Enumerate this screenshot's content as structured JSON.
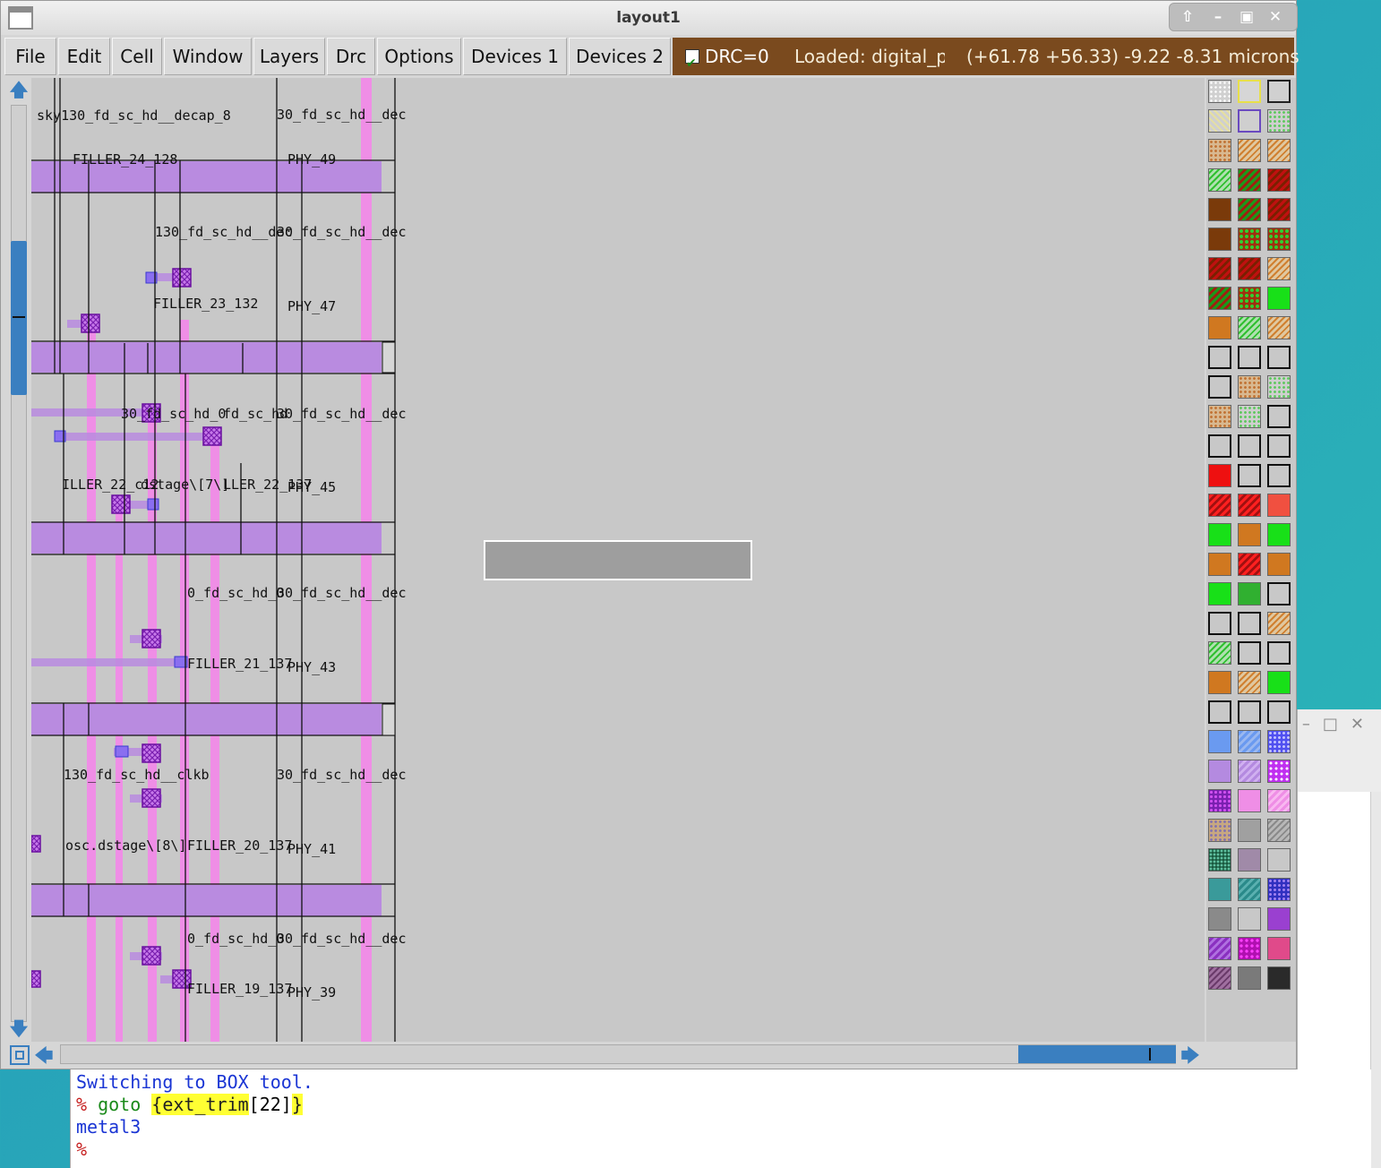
{
  "window": {
    "title": "layout1"
  },
  "menu": [
    "File",
    "Edit",
    "Cell",
    "Window",
    "Layers",
    "Drc",
    "Options",
    "Devices 1",
    "Devices 2"
  ],
  "drc": {
    "label": "DRC=0",
    "checked": true
  },
  "status": {
    "loaded": "Loaded: digital_p",
    "coords": "(+61.78 +56.33) -9.22 -8.31 microns"
  },
  "cells": [
    {
      "text": "sky130_fd_sc_hd__decap_8"
    },
    {
      "text": "30_fd_sc_hd__dec"
    },
    {
      "text": "FILLER_24_128"
    },
    {
      "text": "PHY_49"
    },
    {
      "text": "130_fd_sc_hd__dec"
    },
    {
      "text": "30_fd_sc_hd__dec"
    },
    {
      "text": "FILLER_23_132"
    },
    {
      "text": "PHY_47"
    },
    {
      "text": "30_fd_sc_hd_0"
    },
    {
      "text": "fd_sc_hd"
    },
    {
      "text": "30_fd_sc_hd__dec"
    },
    {
      "text": "ILLER_22_c12"
    },
    {
      "text": "dstage\\[7\\]"
    },
    {
      "text": "LLER_22_137"
    },
    {
      "text": "PHY_45"
    },
    {
      "text": "0_fd_sc_hd_0"
    },
    {
      "text": "30_fd_sc_hd__dec"
    },
    {
      "text": "FILLER_21_137"
    },
    {
      "text": "PHY_43"
    },
    {
      "text": "130_fd_sc_hd__clkb"
    },
    {
      "text": "30_fd_sc_hd__dec"
    },
    {
      "text": "osc.dstage\\[8\\]"
    },
    {
      "text": "FILLER_20_137"
    },
    {
      "text": "PHY_41"
    },
    {
      "text": "0_fd_sc_hd_0"
    },
    {
      "text": "30_fd_sc_hd__dec"
    },
    {
      "text": "FILLER_19_137"
    },
    {
      "text": "PHY_39"
    }
  ],
  "terminal": {
    "line1": "Switching to BOX tool.",
    "prompt": "%",
    "cmd": " goto ",
    "arg_open": "{",
    "arg_name": "ext_trim",
    "arg_index": "[22]",
    "arg_close": "}",
    "line3": "metal3",
    "line4": "%"
  },
  "colors": {
    "status_bg": "#7a4a1e",
    "metal_purple": "#b98be0",
    "metal_pink": "#ef8ee6",
    "scroll_blue": "#3a7fc0"
  },
  "icons": [
    "arrow-up-icon",
    "arrow-down-icon",
    "arrow-left-icon",
    "arrow-right-icon",
    "zoom-box-icon",
    "checkbox-icon",
    "restore-up-icon",
    "minimize-icon",
    "maximize-icon",
    "close-icon"
  ]
}
